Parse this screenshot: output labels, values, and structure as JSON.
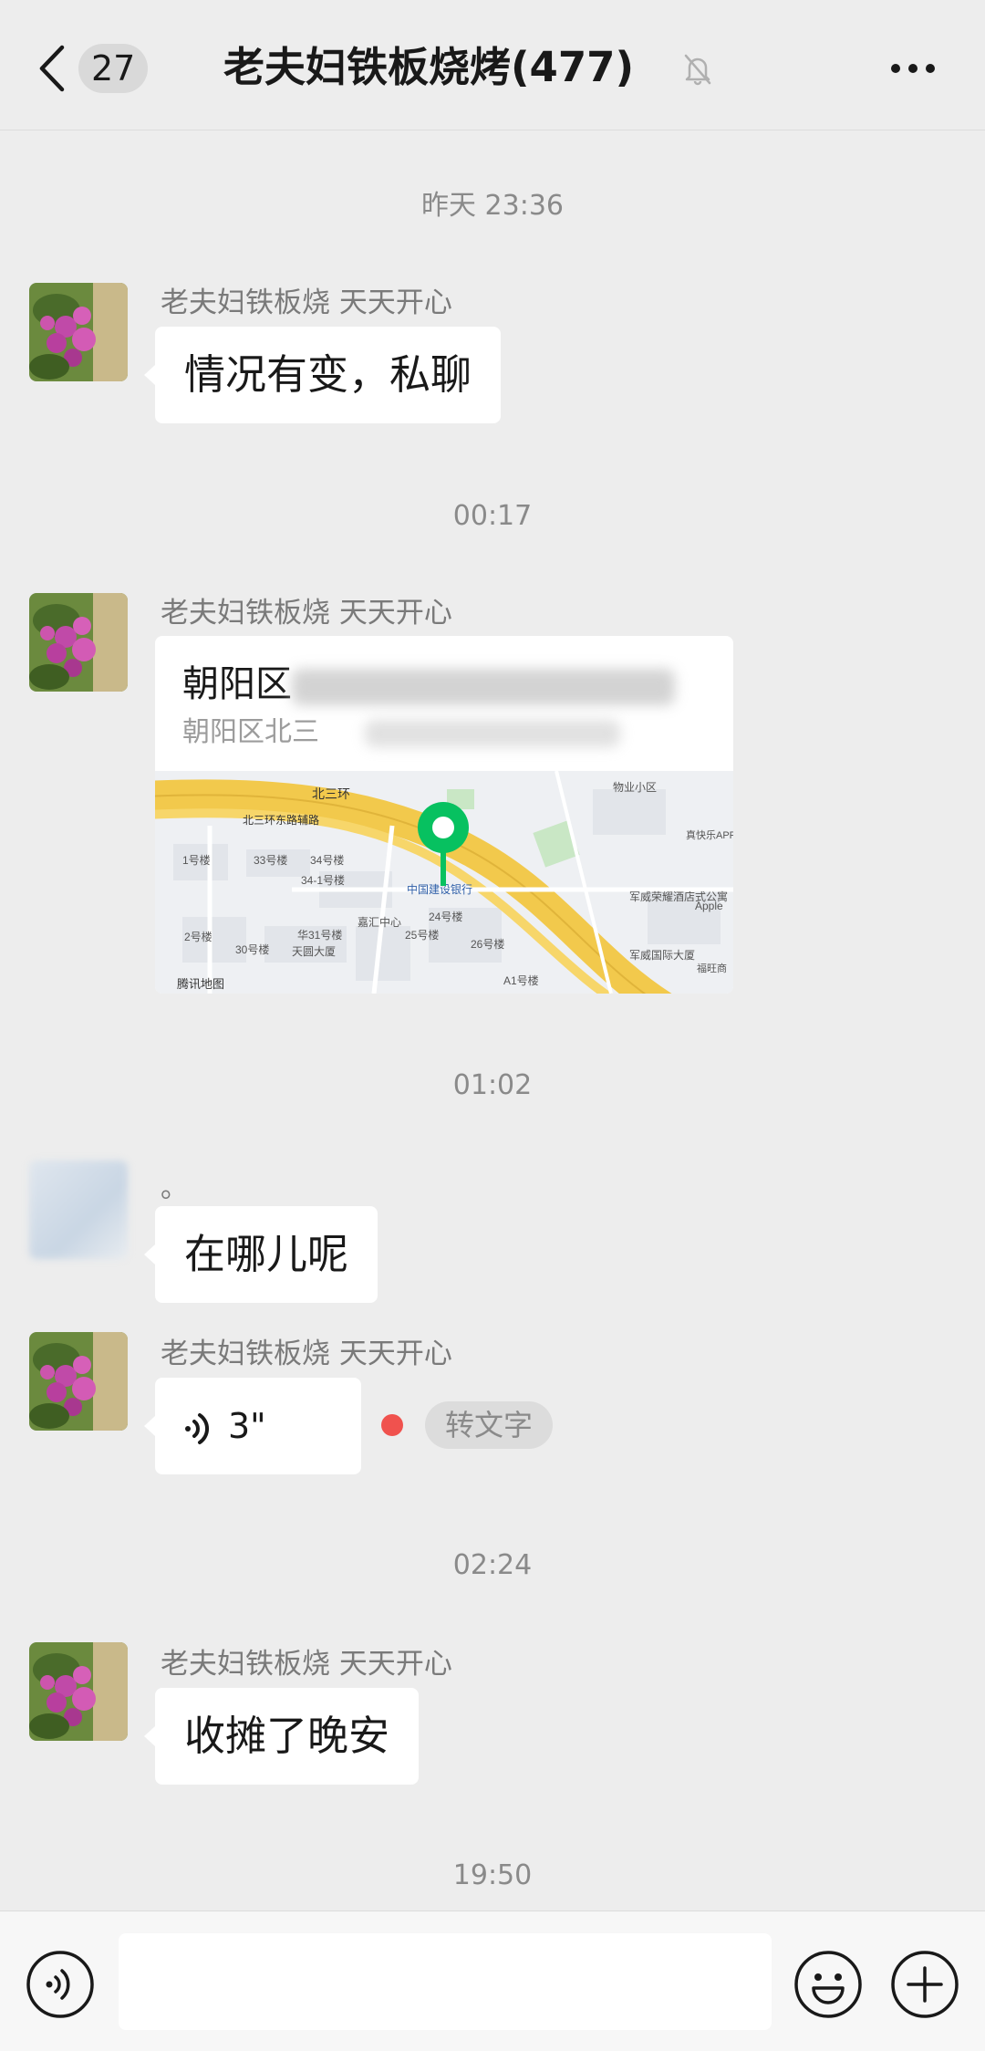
{
  "header": {
    "unread_count": "27",
    "title": "老夫妇铁板烧烤(477)"
  },
  "messages": [
    {
      "timestamp": "昨天 23:36",
      "sender": "老夫妇铁板烧 天天开心",
      "text": "情况有变，私聊"
    },
    {
      "timestamp": "00:17",
      "sender": "老夫妇铁板烧 天天开心",
      "location": {
        "title": "朝阳区",
        "address": "朝阳区北三",
        "map_labels": [
          "北三环",
          "北三环东路辅路",
          "中国建设银行",
          "嘉汇中心",
          "天圆大厦",
          "军威荣耀酒店式公寓",
          "军威国际大厦",
          "真快乐APP体验中心",
          "物业小区",
          "福旺商",
          "1号楼",
          "33号楼",
          "34号楼",
          "34-1号楼",
          "2号楼",
          "30号楼",
          "华31号楼",
          "25号楼",
          "24号楼",
          "26号楼",
          "A1号楼",
          "腾讯地图",
          "Apple"
        ]
      }
    },
    {
      "timestamp": "01:02",
      "sender": "。",
      "text": "在哪儿呢"
    },
    {
      "sender": "老夫妇铁板烧 天天开心",
      "voice_duration": "3\"",
      "transcribe_label": "转文字"
    },
    {
      "timestamp": "02:24",
      "sender": "老夫妇铁板烧 天天开心",
      "text": "收摊了晚安"
    },
    {
      "timestamp": "19:50"
    }
  ],
  "colors": {
    "background": "#ededed",
    "bubble": "#ffffff",
    "unread_dot": "#f0524e",
    "map_pin": "#07c160",
    "road": "#f2c94c"
  },
  "icons": [
    "back-chevron-icon",
    "mute-bell-icon",
    "more-icon",
    "voice-wave-icon",
    "voice-input-icon",
    "emoji-icon",
    "plus-icon",
    "map-pin-icon"
  ]
}
